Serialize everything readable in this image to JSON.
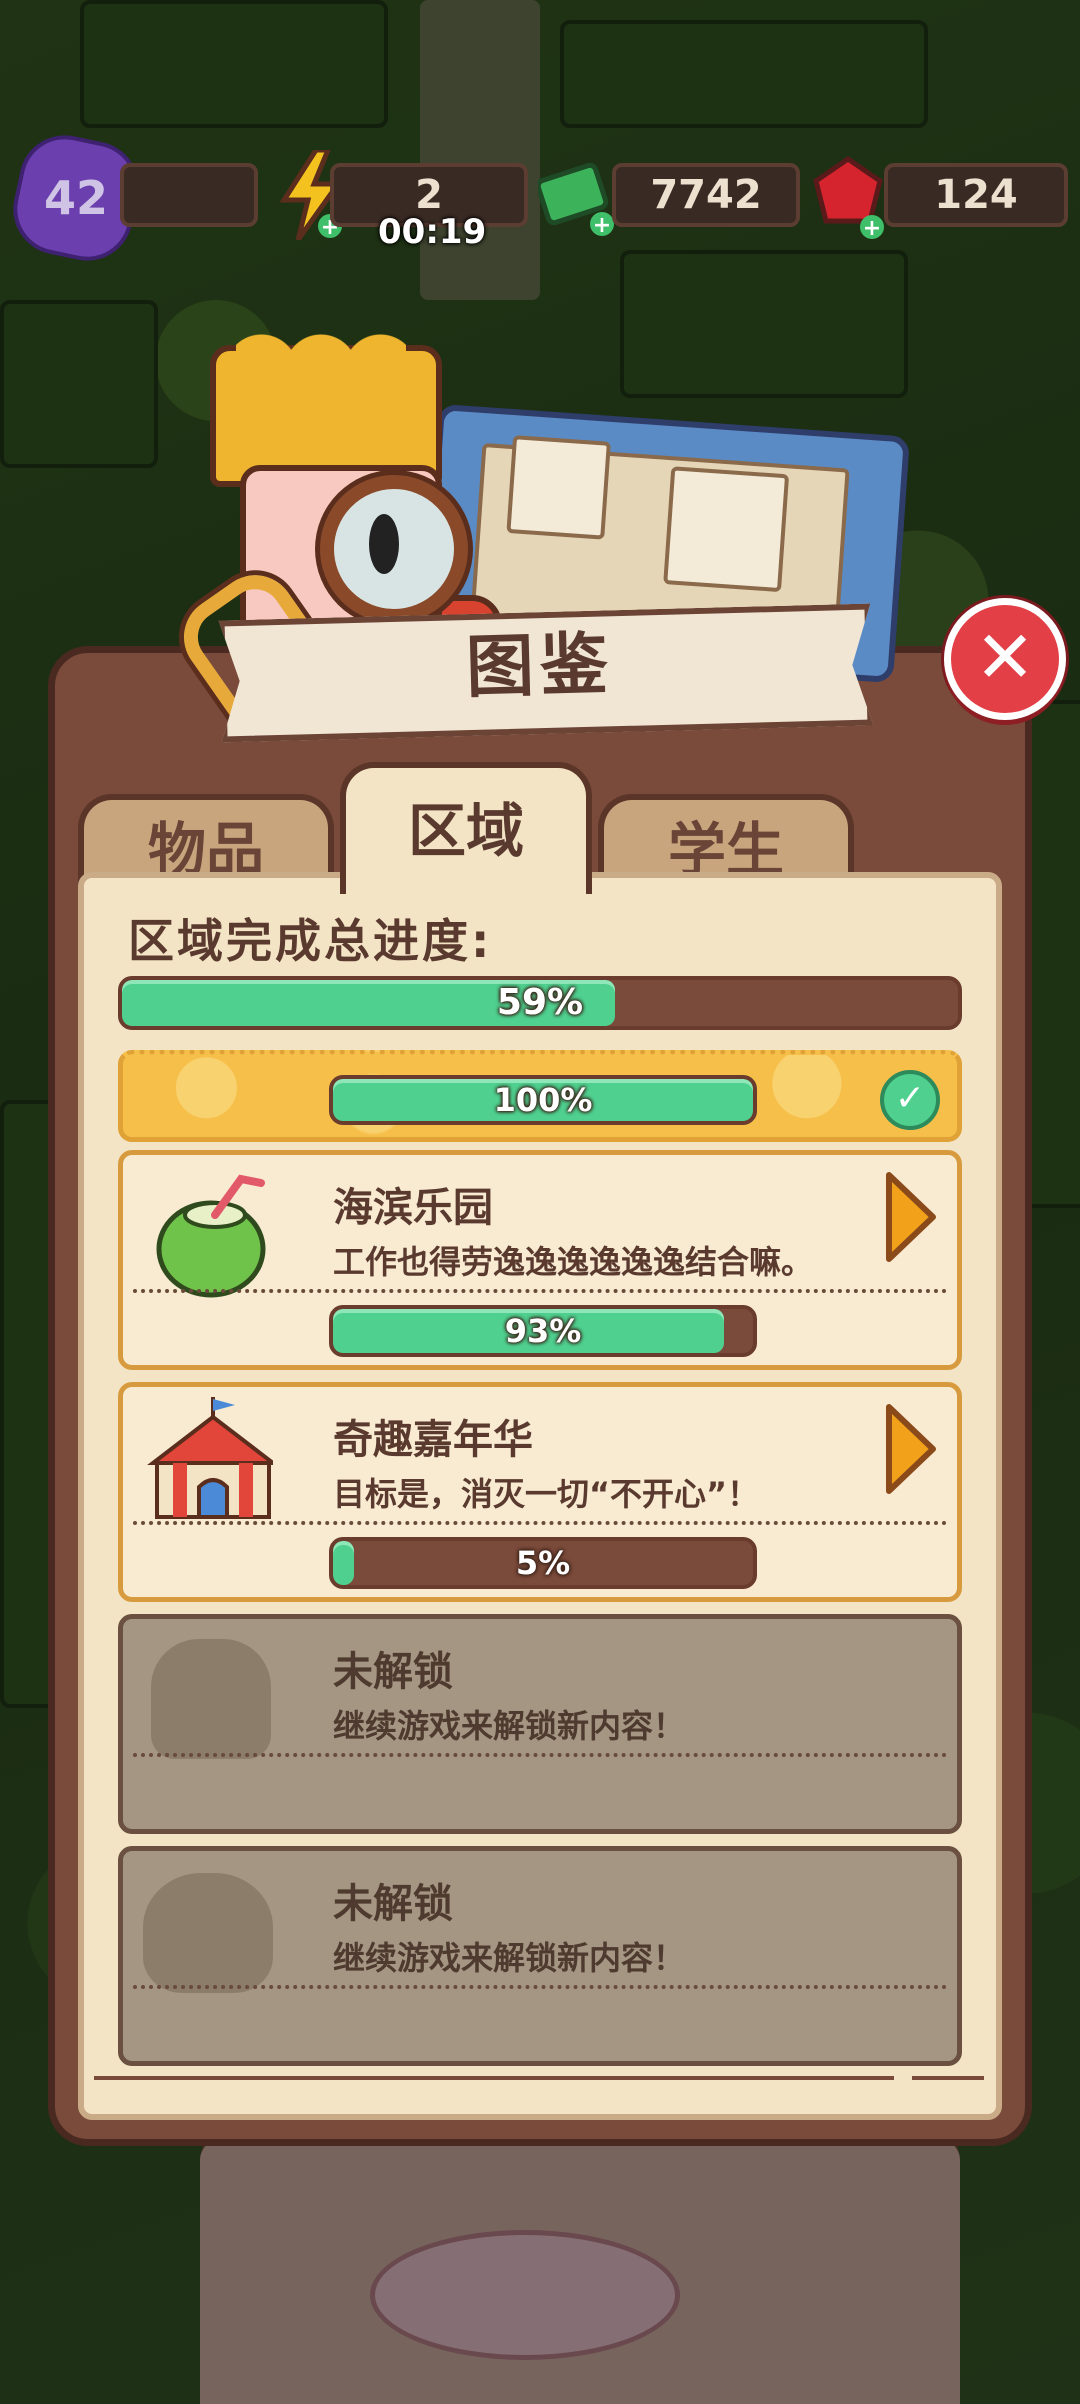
{
  "hud": {
    "level": "42",
    "energy": "2",
    "energy_timer": "00:19",
    "cash": "7742",
    "gems": "124"
  },
  "title": "图鉴",
  "tabs": [
    {
      "label": "物品",
      "active": false
    },
    {
      "label": "区域",
      "active": true
    },
    {
      "label": "学生",
      "active": false
    }
  ],
  "total_progress": {
    "label": "区域完成总进度:",
    "value": 0.59,
    "text": "59%"
  },
  "areas": [
    {
      "name": "",
      "desc": "",
      "progress": 1.0,
      "text": "100%",
      "completed": true
    },
    {
      "name": "海滨乐园",
      "desc": "工作也得劳逸逸逸逸逸逸结合嘛。",
      "progress": 0.93,
      "text": "93%",
      "icon": "coconut-drink-icon"
    },
    {
      "name": "奇趣嘉年华",
      "desc": "目标是，消灭一切“不开心”！",
      "progress": 0.05,
      "text": "5%",
      "icon": "circus-tent-icon"
    },
    {
      "name": "未解锁",
      "desc": "继续游戏来解锁新内容！",
      "locked": true
    },
    {
      "name": "未解锁",
      "desc": "继续游戏来解锁新内容！",
      "locked": true
    }
  ],
  "colors": {
    "progress_fill": "#4fd08f",
    "panel": "#7a4b3b",
    "content_bg": "#f4e4c6",
    "close": "#e23f46",
    "arrow": "#f2a21a"
  }
}
